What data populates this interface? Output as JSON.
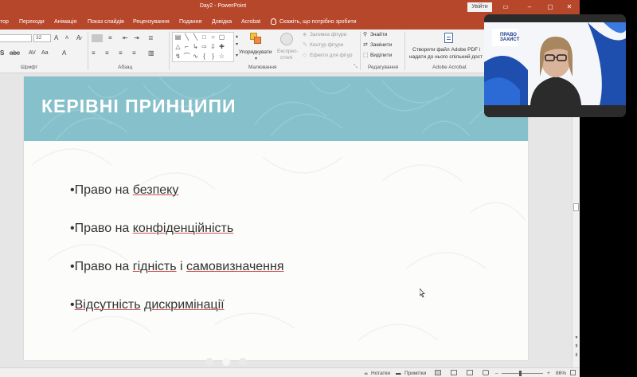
{
  "window": {
    "title": "Day2  -  PowerPoint",
    "signin_label": "Увійти",
    "controls": [
      "▭",
      "–",
      "▢",
      "✕"
    ]
  },
  "tabs": [
    {
      "label": "тор"
    },
    {
      "label": "Переходи"
    },
    {
      "label": "Анімація"
    },
    {
      "label": "Показ слайдів"
    },
    {
      "label": "Рецензування"
    },
    {
      "label": "Подання"
    },
    {
      "label": "Довідка"
    },
    {
      "label": "Acrobat"
    }
  ],
  "tell_me": "Скажіть, що потрібно зробити",
  "ribbon": {
    "font": {
      "font_name": "",
      "font_size": "32",
      "label": "Шрифт"
    },
    "paragraph": {
      "label": "Абзац"
    },
    "drawing": {
      "arrange": "Упорядкувати",
      "quick_styles_line1": "Експрес-",
      "quick_styles_line2": "стилі",
      "shape_fill": "Заливка фігури",
      "shape_outline": "Контур фігури",
      "shape_effects": "Ефекти для фігур",
      "label": "Малювання"
    },
    "editing": {
      "find": "Знайти",
      "replace": "Замінити",
      "select": "Виділити",
      "label": "Редагування"
    },
    "acrobat": {
      "line1": "Створити файл Adobe PDF і",
      "line2": "надати до нього спільний дост",
      "label": "Adobe Acrobat"
    }
  },
  "slide": {
    "title": "КЕРІВНІ ПРИНЦИПИ",
    "bullets": [
      {
        "bullet": "•",
        "plain": "Право на ",
        "underlined": "безпеку",
        "rest": "",
        "underlined2": ""
      },
      {
        "bullet": "•",
        "plain": "Право на ",
        "underlined": "конфіденційність",
        "rest": "",
        "underlined2": ""
      },
      {
        "bullet": "•",
        "plain": "Право на ",
        "underlined": "гідність",
        "rest": " і ",
        "underlined2": "самовизначення"
      },
      {
        "bullet": "•",
        "plain": "",
        "underlined": "Відсутність",
        "rest": " ",
        "underlined2": "дискримінації"
      }
    ]
  },
  "statusbar": {
    "notes": "Нотатки",
    "comments": "Примітки",
    "zoom": "86%",
    "zoom_minus": "–",
    "zoom_plus": "+"
  },
  "webcam": {
    "logo_line1": "ПРАВО",
    "logo_line2": "ЗАХИСТ"
  },
  "colors": {
    "powerpoint_accent": "#b7472a",
    "slide_banner": "#86c0ca",
    "underline": "#d05050"
  }
}
